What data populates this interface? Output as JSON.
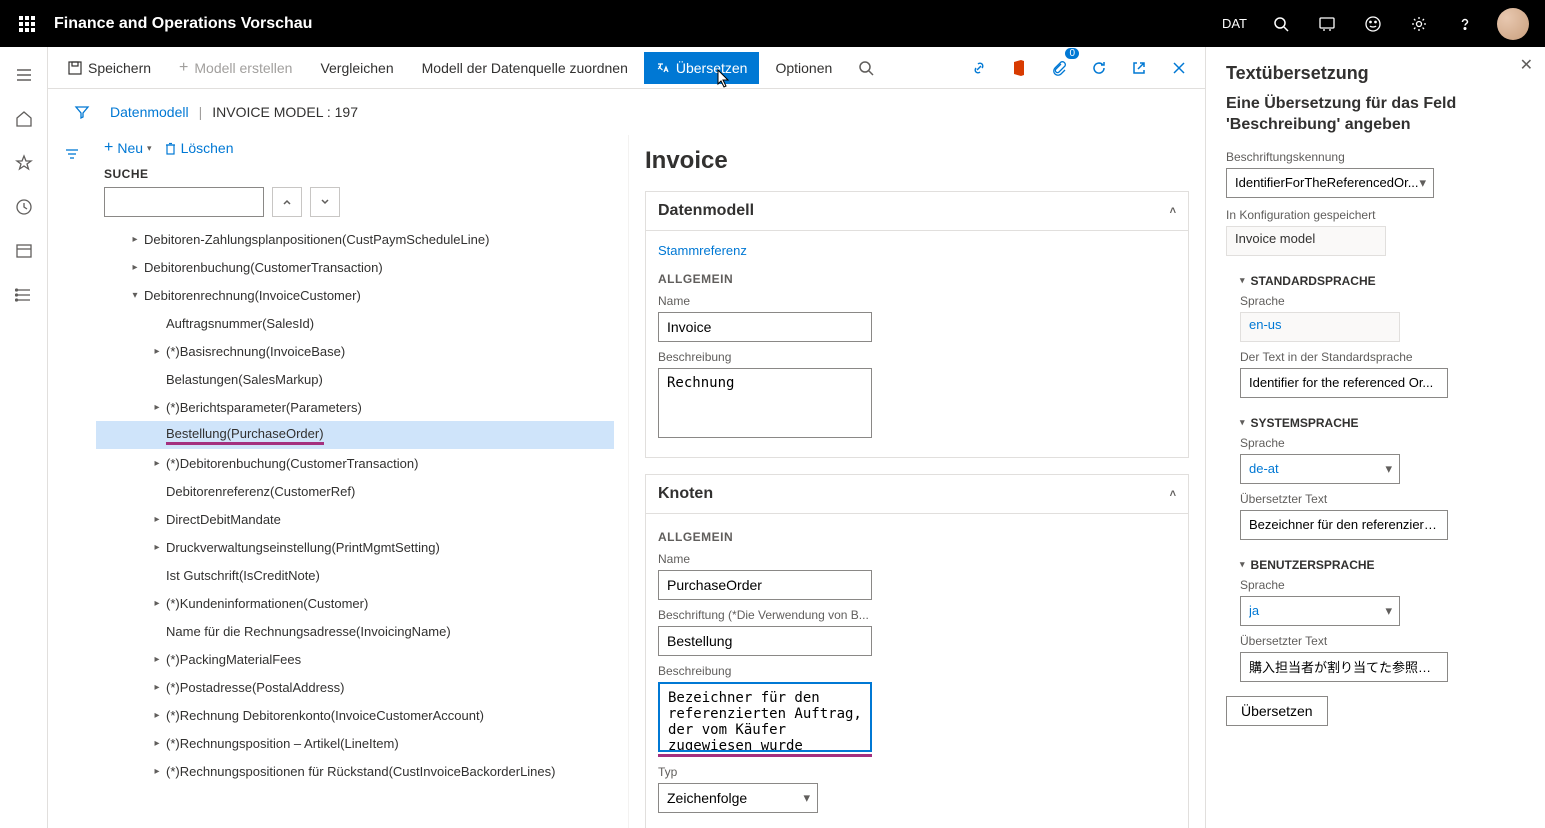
{
  "topbar": {
    "brand": "Finance and Operations Vorschau",
    "company": "DAT"
  },
  "actionbar": {
    "save": "Speichern",
    "new_model": "Modell erstellen",
    "compare": "Vergleichen",
    "map_model": "Modell der Datenquelle zuordnen",
    "translate": "Übersetzen",
    "options": "Optionen",
    "badge_count": "0"
  },
  "breadcrumb": {
    "root": "Datenmodell",
    "current": "INVOICE MODEL : 197"
  },
  "tree_tools": {
    "new": "Neu",
    "delete": "Löschen"
  },
  "search": {
    "label": "SUCHE",
    "value": ""
  },
  "tree": [
    {
      "indent": 1,
      "caret": "r",
      "label": "Debitoren-Zahlungsplanpositionen(CustPaymScheduleLine)"
    },
    {
      "indent": 1,
      "caret": "r",
      "label": "Debitorenbuchung(CustomerTransaction)"
    },
    {
      "indent": 1,
      "caret": "d",
      "label": "Debitorenrechnung(InvoiceCustomer)"
    },
    {
      "indent": 2,
      "caret": "",
      "label": "Auftragsnummer(SalesId)"
    },
    {
      "indent": 2,
      "caret": "r",
      "label": "(*)Basisrechnung(InvoiceBase)"
    },
    {
      "indent": 2,
      "caret": "",
      "label": "Belastungen(SalesMarkup)"
    },
    {
      "indent": 2,
      "caret": "r",
      "label": "(*)Berichtsparameter(Parameters)"
    },
    {
      "indent": 2,
      "caret": "",
      "label": "Bestellung(PurchaseOrder)",
      "selected": true,
      "underline": true
    },
    {
      "indent": 2,
      "caret": "r",
      "label": "(*)Debitorenbuchung(CustomerTransaction)"
    },
    {
      "indent": 2,
      "caret": "",
      "label": "Debitorenreferenz(CustomerRef)"
    },
    {
      "indent": 2,
      "caret": "r",
      "label": "DirectDebitMandate"
    },
    {
      "indent": 2,
      "caret": "r",
      "label": "Druckverwaltungseinstellung(PrintMgmtSetting)"
    },
    {
      "indent": 2,
      "caret": "",
      "label": "Ist Gutschrift(IsCreditNote)"
    },
    {
      "indent": 2,
      "caret": "r",
      "label": "(*)Kundeninformationen(Customer)"
    },
    {
      "indent": 2,
      "caret": "",
      "label": "Name für die Rechnungsadresse(InvoicingName)"
    },
    {
      "indent": 2,
      "caret": "r",
      "label": "(*)PackingMaterialFees"
    },
    {
      "indent": 2,
      "caret": "r",
      "label": "(*)Postadresse(PostalAddress)"
    },
    {
      "indent": 2,
      "caret": "r",
      "label": "(*)Rechnung Debitorenkonto(InvoiceCustomerAccount)"
    },
    {
      "indent": 2,
      "caret": "r",
      "label": "(*)Rechnungsposition – Artikel(LineItem)"
    },
    {
      "indent": 2,
      "caret": "r",
      "label": "(*)Rechnungspositionen für Rückstand(CustInvoiceBackorderLines)"
    }
  ],
  "details": {
    "title": "Invoice",
    "s1_title": "Datenmodell",
    "s1_link": "Stammreferenz",
    "s1_sub": "ALLGEMEIN",
    "s1_name_label": "Name",
    "s1_name_value": "Invoice",
    "s1_desc_label": "Beschreibung",
    "s1_desc_value": "Rechnung",
    "s2_title": "Knoten",
    "s2_sub": "ALLGEMEIN",
    "s2_name_label": "Name",
    "s2_name_value": "PurchaseOrder",
    "s2_cap_label": "Beschriftung (*Die Verwendung von B...",
    "s2_cap_value": "Bestellung",
    "s2_desc_label": "Beschreibung",
    "s2_desc_value": "Bezeichner für den referenzierten Auftrag, der vom Käufer zugewiesen wurde",
    "s2_type_label": "Typ",
    "s2_type_value": "Zeichenfolge"
  },
  "panel": {
    "title": "Textübersetzung",
    "subtitle": "Eine Übersetzung für das Feld 'Beschreibung' angeben",
    "id_label": "Beschriftungskennung",
    "id_value": "IdentifierForTheReferencedOr...",
    "saved_label": "In Konfiguration gespeichert",
    "saved_value": "Invoice model",
    "g1_title": "STANDARDSPRACHE",
    "g1_lang_label": "Sprache",
    "g1_lang_value": "en-us",
    "g1_text_label": "Der Text in der Standardsprache",
    "g1_text_value": "Identifier for the referenced Or...",
    "g2_title": "SYSTEMSPRACHE",
    "g2_lang_label": "Sprache",
    "g2_lang_value": "de-at",
    "g2_text_label": "Übersetzter Text",
    "g2_text_value": "Bezeichner für den referenzierte...",
    "g3_title": "BENUTZERSPRACHE",
    "g3_lang_label": "Sprache",
    "g3_lang_value": "ja",
    "g3_text_label": "Übersetzter Text",
    "g3_text_value": "購入担当者が割り当てた参照オ...",
    "btn": "Übersetzen"
  }
}
